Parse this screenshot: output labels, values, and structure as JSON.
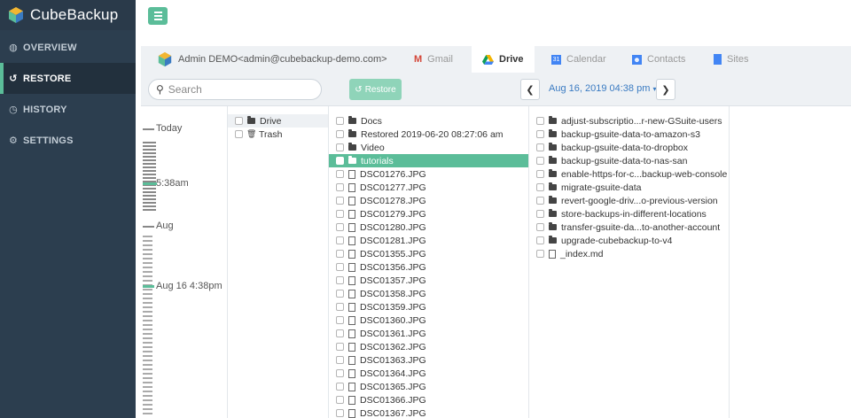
{
  "app": {
    "title": "CubeBackup"
  },
  "sidebar": {
    "items": [
      {
        "label": "OVERVIEW",
        "icon": "dashboard-icon",
        "active": false
      },
      {
        "label": "RESTORE",
        "icon": "restore-icon",
        "active": true
      },
      {
        "label": "HISTORY",
        "icon": "history-icon",
        "active": false
      },
      {
        "label": "SETTINGS",
        "icon": "gear-icon",
        "active": false
      }
    ]
  },
  "account": {
    "name": "Admin DEMO<admin@cubebackup-demo.com>"
  },
  "tabs": [
    {
      "label": "Gmail",
      "icon": "gmail-icon"
    },
    {
      "label": "Drive",
      "icon": "drive-icon"
    },
    {
      "label": "Calendar",
      "icon": "calendar-icon"
    },
    {
      "label": "Contacts",
      "icon": "contacts-icon"
    },
    {
      "label": "Sites",
      "icon": "sites-icon"
    }
  ],
  "toolbar": {
    "search_placeholder": "Search",
    "restore_label": "Restore",
    "date_label": "Aug 16, 2019 04:38 pm"
  },
  "timeline": {
    "labels": [
      "Today",
      "5:38am",
      "Aug",
      "Aug 16 4:38pm"
    ]
  },
  "drive_tree": [
    {
      "label": "Drive",
      "icon": "folder-icon"
    },
    {
      "label": "Trash",
      "icon": "trash-icon"
    }
  ],
  "files": [
    {
      "label": "Docs",
      "type": "folder"
    },
    {
      "label": "Restored 2019-06-20 08:27:06 am",
      "type": "folder"
    },
    {
      "label": "Video",
      "type": "folder"
    },
    {
      "label": "tutorials",
      "type": "folder",
      "selected": true
    },
    {
      "label": "DSC01276.JPG",
      "type": "image"
    },
    {
      "label": "DSC01277.JPG",
      "type": "image"
    },
    {
      "label": "DSC01278.JPG",
      "type": "image"
    },
    {
      "label": "DSC01279.JPG",
      "type": "image"
    },
    {
      "label": "DSC01280.JPG",
      "type": "image"
    },
    {
      "label": "DSC01281.JPG",
      "type": "image"
    },
    {
      "label": "DSC01355.JPG",
      "type": "image"
    },
    {
      "label": "DSC01356.JPG",
      "type": "image"
    },
    {
      "label": "DSC01357.JPG",
      "type": "image"
    },
    {
      "label": "DSC01358.JPG",
      "type": "image"
    },
    {
      "label": "DSC01359.JPG",
      "type": "image"
    },
    {
      "label": "DSC01360.JPG",
      "type": "image"
    },
    {
      "label": "DSC01361.JPG",
      "type": "image"
    },
    {
      "label": "DSC01362.JPG",
      "type": "image"
    },
    {
      "label": "DSC01363.JPG",
      "type": "image"
    },
    {
      "label": "DSC01364.JPG",
      "type": "image"
    },
    {
      "label": "DSC01365.JPG",
      "type": "image"
    },
    {
      "label": "DSC01366.JPG",
      "type": "image"
    },
    {
      "label": "DSC01367.JPG",
      "type": "image"
    }
  ],
  "subfiles": [
    {
      "label": "adjust-subscriptio...r-new-GSuite-users",
      "type": "folder"
    },
    {
      "label": "backup-gsuite-data-to-amazon-s3",
      "type": "folder"
    },
    {
      "label": "backup-gsuite-data-to-dropbox",
      "type": "folder"
    },
    {
      "label": "backup-gsuite-data-to-nas-san",
      "type": "folder"
    },
    {
      "label": "enable-https-for-c...backup-web-console",
      "type": "folder"
    },
    {
      "label": "migrate-gsuite-data",
      "type": "folder"
    },
    {
      "label": "revert-google-driv...o-previous-version",
      "type": "folder"
    },
    {
      "label": "store-backups-in-different-locations",
      "type": "folder"
    },
    {
      "label": "transfer-gsuite-da...to-another-account",
      "type": "folder"
    },
    {
      "label": "upgrade-cubebackup-to-v4",
      "type": "folder"
    },
    {
      "label": "_index.md",
      "type": "file"
    }
  ],
  "colors": {
    "accent": "#5bbd99",
    "sidebar": "#2c3e4f",
    "link": "#3a7bc2"
  }
}
